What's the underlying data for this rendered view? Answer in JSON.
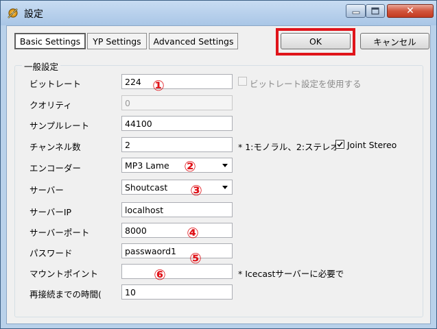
{
  "window": {
    "title": "設定",
    "close_glyph": "✕"
  },
  "tabs": [
    {
      "label": "Basic Settings",
      "active": true
    },
    {
      "label": "YP Settings",
      "active": false
    },
    {
      "label": "Advanced Settings",
      "active": false
    }
  ],
  "buttons": {
    "ok": "OK",
    "cancel": "キャンセル"
  },
  "group": {
    "title": "一般設定"
  },
  "rows": {
    "bitrate": {
      "label": "ビットレート",
      "value": "224"
    },
    "quality": {
      "label": "クオリティ",
      "value": "0"
    },
    "samplerate": {
      "label": "サンプルレート",
      "value": "44100"
    },
    "channels": {
      "label": "チャンネル数",
      "value": "2"
    },
    "encoder": {
      "label": "エンコーダー",
      "value": "MP3 Lame"
    },
    "server": {
      "label": "サーバー",
      "value": "Shoutcast"
    },
    "server_ip": {
      "label": "サーバーIP",
      "value": "localhost"
    },
    "server_port": {
      "label": "サーバーポート",
      "value": "8000"
    },
    "password": {
      "label": "パスワード",
      "value": "passwaord1"
    },
    "mount_point": {
      "label": "マウントポイント",
      "value": ""
    },
    "reconnect": {
      "label": "再接続までの時間(",
      "value": "10"
    }
  },
  "options": {
    "use_bitrate": {
      "label": "ビットレート設定を使用する",
      "checked": false,
      "enabled": false
    },
    "joint_stereo": {
      "label": "Joint Stereo",
      "checked": true,
      "enabled": true
    }
  },
  "notes": {
    "channels": "* 1:モノラル、2:ステレオ",
    "mount": "* Icecastサーバーに必要で"
  },
  "annotations": [
    "①",
    "②",
    "③",
    "④",
    "⑤",
    "⑥"
  ],
  "colors": {
    "highlight_red": "#e0141a",
    "window_frame": "#b9d1ea",
    "close_button": "#c23a20"
  },
  "icons": {
    "app": "gear-pencil-icon",
    "minimize": "minimize-icon",
    "maximize": "maximize-icon",
    "close": "close-icon",
    "checkmark": "checkmark-icon"
  }
}
